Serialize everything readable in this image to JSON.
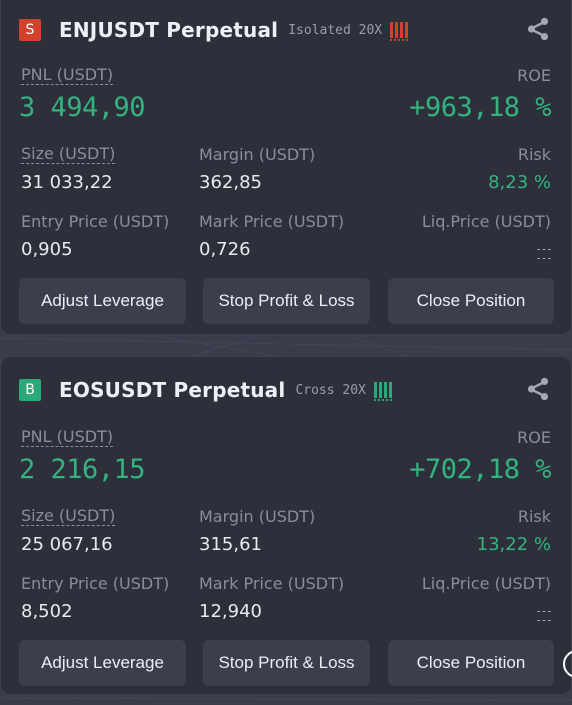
{
  "positions": [
    {
      "side_letter": "S",
      "symbol": "ENJUSDT Perpetual",
      "margin_mode": "Isolated 20X",
      "pnl_label": "PNL (USDT)",
      "pnl_value": "3 494,90",
      "roe_label": "ROE",
      "roe_value": "+963,18 %",
      "size_label": "Size (USDT)",
      "size_value": "31 033,22",
      "margin_label": "Margin (USDT)",
      "margin_value": "362,85",
      "risk_label": "Risk",
      "risk_value": "8,23 %",
      "entry_label": "Entry Price (USDT)",
      "entry_value": "0,905",
      "mark_label": "Mark Price (USDT)",
      "mark_value": "0,726",
      "liq_label": "Liq.Price (USDT)",
      "buttons": {
        "adjust": "Adjust Leverage",
        "stop": "Stop Profit & Loss",
        "close": "Close Position"
      }
    },
    {
      "side_letter": "B",
      "symbol": "EOSUSDT Perpetual",
      "margin_mode": "Cross 20X",
      "pnl_label": "PNL (USDT)",
      "pnl_value": "2 216,15",
      "roe_label": "ROE",
      "roe_value": "+702,18 %",
      "size_label": "Size (USDT)",
      "size_value": "25 067,16",
      "margin_label": "Margin (USDT)",
      "margin_value": "315,61",
      "risk_label": "Risk",
      "risk_value": "13,22 %",
      "entry_label": "Entry Price (USDT)",
      "entry_value": "8,502",
      "mark_label": "Mark Price (USDT)",
      "mark_value": "12,940",
      "liq_label": "Liq.Price (USDT)",
      "buttons": {
        "adjust": "Adjust Leverage",
        "stop": "Stop Profit & Loss",
        "close": "Close Position"
      }
    }
  ],
  "icons": {
    "share": "share-icon",
    "leverage_bars": "leverage-bars-icon"
  },
  "colors": {
    "profit_green": "#36b27f",
    "sell_red": "#d2412d",
    "buy_green": "#2aa87a",
    "card_bg": "#2d2f3b",
    "button_bg": "#3b3e4d"
  }
}
